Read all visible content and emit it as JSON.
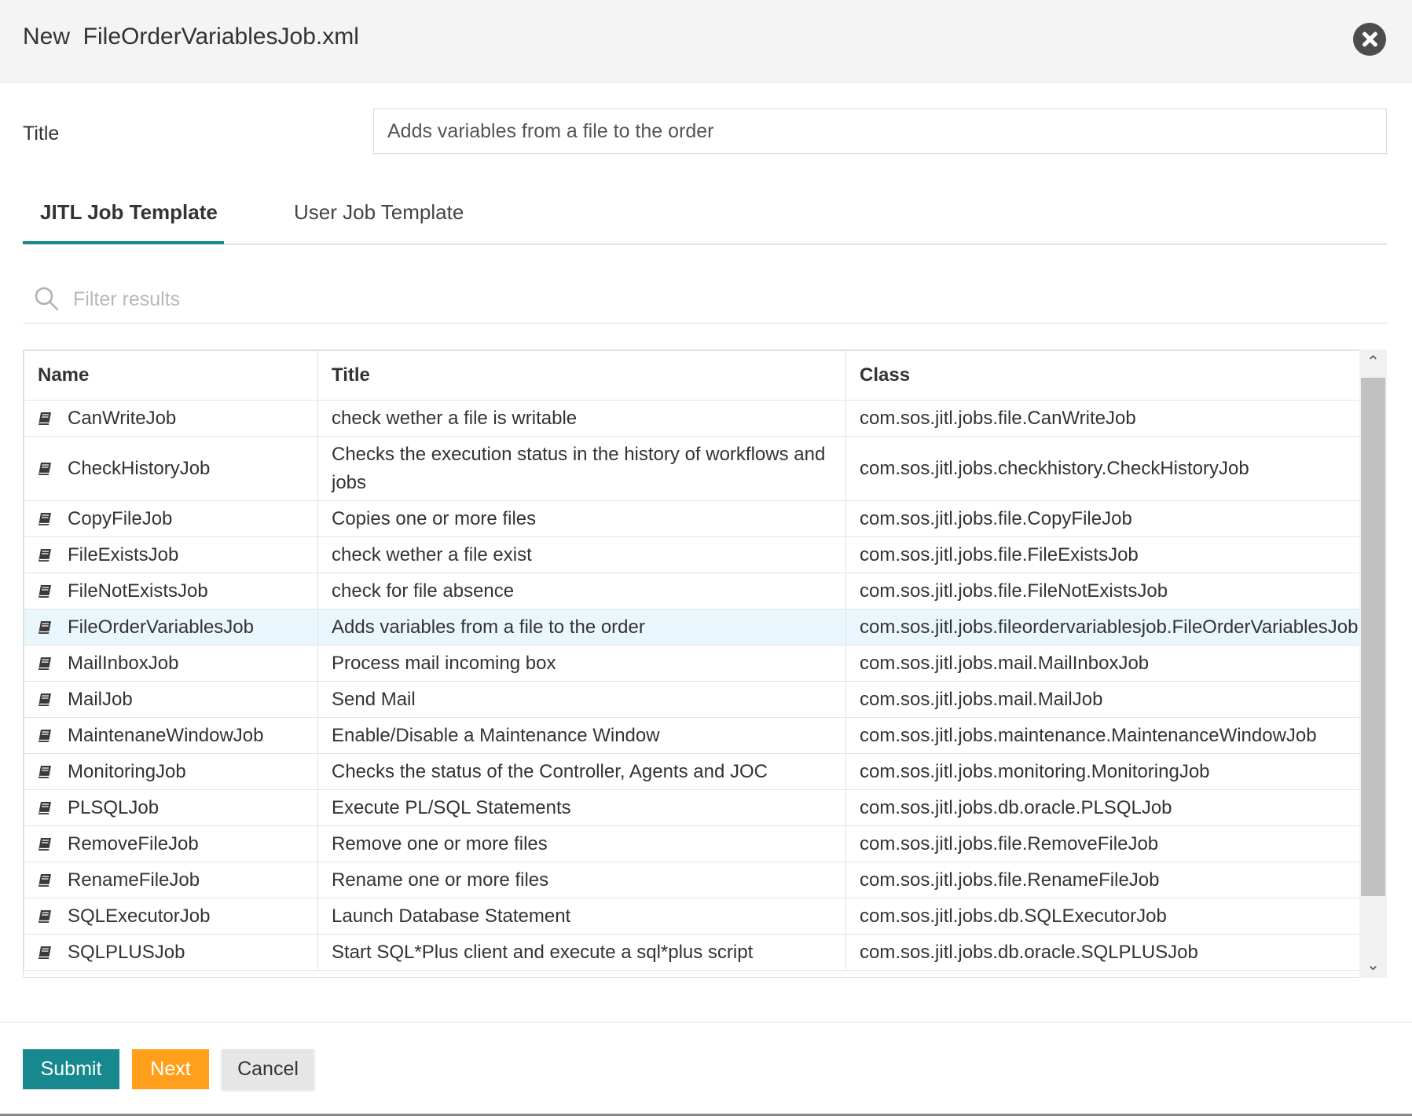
{
  "header": {
    "title": "New  FileOrderVariablesJob.xml",
    "close_icon": "close-circle-icon"
  },
  "form": {
    "title_label": "Title",
    "title_value": "Adds variables from a file to the order"
  },
  "tabs": [
    {
      "label": "JITL Job Template",
      "active": true
    },
    {
      "label": "User Job Template",
      "active": false
    }
  ],
  "filter": {
    "placeholder": "Filter results",
    "icon": "search-icon"
  },
  "table": {
    "columns": [
      "Name",
      "Title",
      "Class"
    ],
    "row_icon": "book-icon",
    "rows": [
      {
        "name": "CanWriteJob",
        "title": "check wether a file is writable",
        "class": "com.sos.jitl.jobs.file.CanWriteJob"
      },
      {
        "name": "CheckHistoryJob",
        "title": "Checks the execution status in the history of workflows and jobs",
        "class": "com.sos.jitl.jobs.checkhistory.CheckHistoryJob"
      },
      {
        "name": "CopyFileJob",
        "title": "Copies one or more files",
        "class": "com.sos.jitl.jobs.file.CopyFileJob"
      },
      {
        "name": "FileExistsJob",
        "title": "check wether a file exist",
        "class": "com.sos.jitl.jobs.file.FileExistsJob"
      },
      {
        "name": "FileNotExistsJob",
        "title": "check for file absence",
        "class": "com.sos.jitl.jobs.file.FileNotExistsJob"
      },
      {
        "name": "FileOrderVariablesJob",
        "title": "Adds variables from a file to the order",
        "class": "com.sos.jitl.jobs.fileordervariablesjob.FileOrderVariablesJob",
        "selected": true
      },
      {
        "name": "MailInboxJob",
        "title": "Process mail incoming box",
        "class": "com.sos.jitl.jobs.mail.MailInboxJob"
      },
      {
        "name": "MailJob",
        "title": "Send Mail",
        "class": "com.sos.jitl.jobs.mail.MailJob"
      },
      {
        "name": "MaintenaneWindowJob",
        "title": "Enable/Disable a Maintenance Window",
        "class": "com.sos.jitl.jobs.maintenance.MaintenanceWindowJob"
      },
      {
        "name": "MonitoringJob",
        "title": "Checks the status of the Controller, Agents and JOC",
        "class": "com.sos.jitl.jobs.monitoring.MonitoringJob"
      },
      {
        "name": "PLSQLJob",
        "title": "Execute PL/SQL Statements",
        "class": "com.sos.jitl.jobs.db.oracle.PLSQLJob"
      },
      {
        "name": "RemoveFileJob",
        "title": "Remove one or more files",
        "class": "com.sos.jitl.jobs.file.RemoveFileJob"
      },
      {
        "name": "RenameFileJob",
        "title": "Rename one or more files",
        "class": "com.sos.jitl.jobs.file.RenameFileJob"
      },
      {
        "name": "SQLExecutorJob",
        "title": "Launch Database Statement",
        "class": "com.sos.jitl.jobs.db.SQLExecutorJob"
      },
      {
        "name": "SQLPLUSJob",
        "title": "Start SQL*Plus client and execute a sql*plus script",
        "class": "com.sos.jitl.jobs.db.oracle.SQLPLUSJob"
      }
    ]
  },
  "footer": {
    "submit_label": "Submit",
    "next_label": "Next",
    "cancel_label": "Cancel"
  },
  "colors": {
    "accent": "#17888d",
    "next": "#ff9f1c",
    "selected_row": "#e9f6fc"
  }
}
